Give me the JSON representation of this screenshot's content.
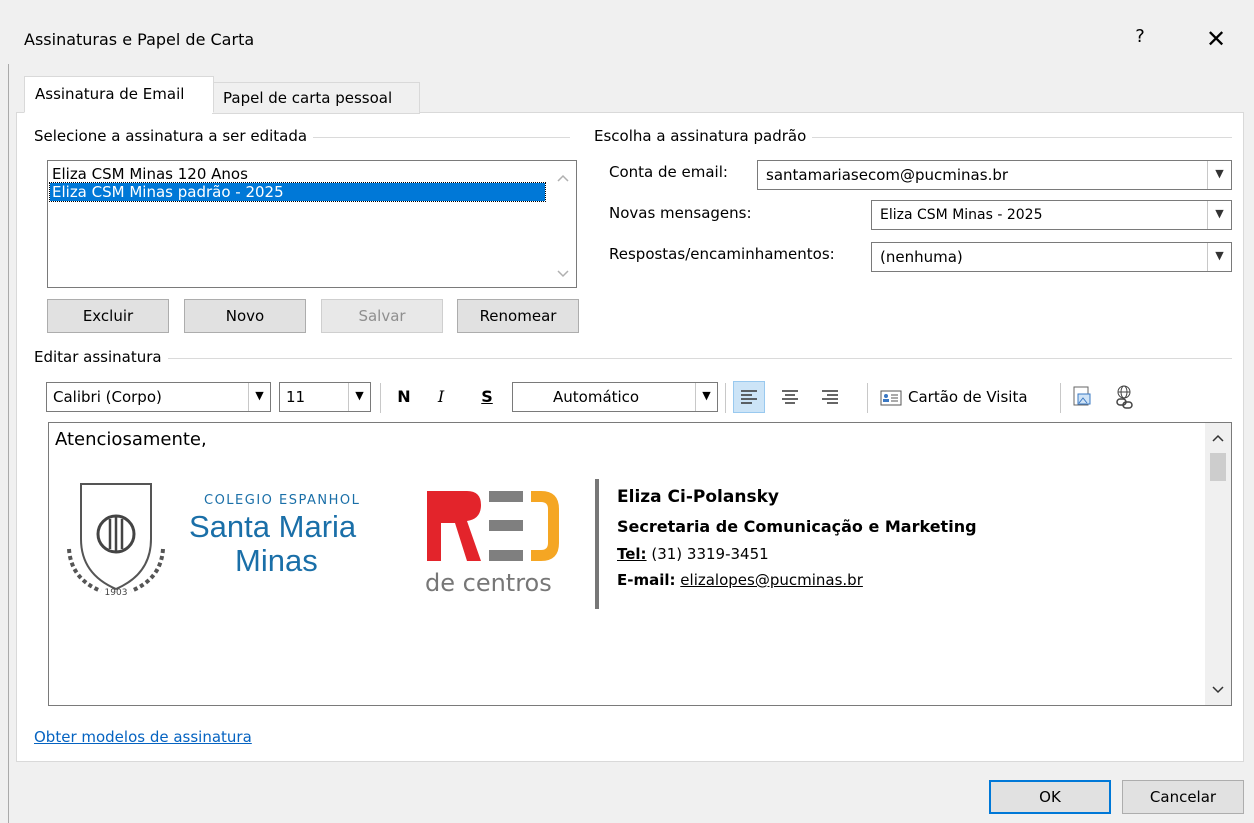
{
  "window": {
    "title": "Assinaturas e Papel de Carta",
    "help": "?",
    "close": "✕"
  },
  "tabs": [
    {
      "label": "Assinatura de Email",
      "active": true
    },
    {
      "label": "Papel de carta pessoal",
      "active": false
    }
  ],
  "select_section": {
    "label": "Selecione a assinatura a ser editada",
    "items": [
      "Eliza CSM Minas 120 Anos",
      "Eliza CSM Minas padrão - 2025"
    ],
    "selected_index": 1,
    "buttons": {
      "delete": "Excluir",
      "new": "Novo",
      "save": "Salvar",
      "rename": "Renomear"
    }
  },
  "default_section": {
    "label": "Escolha a assinatura padrão",
    "account_label": "Conta de email:",
    "account_value": "santamariasecom@pucminas.br",
    "new_messages_label": "Novas mensagens:",
    "new_messages_value": "Eliza CSM Minas - 2025",
    "replies_label": "Respostas/encaminhamentos:",
    "replies_value": "(nenhuma)"
  },
  "edit_section": {
    "label": "Editar assinatura",
    "font_value": "Calibri (Corpo)",
    "size_value": "11",
    "bold": "N",
    "italic": "I",
    "underline": "S",
    "color_value": "Automático",
    "business_card": "Cartão de Visita"
  },
  "signature": {
    "greeting": "Atenciosamente,",
    "school_line1": "COLEGIO ESPANHOL",
    "school_line2": "Santa Maria",
    "school_line3": "Minas",
    "school_year": "1903",
    "red_text": "RED",
    "red_sub": "de centros",
    "name": "Eliza Ci-Polansky",
    "role": "Secretaria de Comunicação e Marketing",
    "tel_label": "Tel:",
    "tel_value": "(31) 3319-3451",
    "email_label": "E-mail:",
    "email_value": "elizalopes@pucminas.br"
  },
  "footer": {
    "templates_link": "Obter modelos de assinatura",
    "ok": "OK",
    "cancel": "Cancelar"
  },
  "colors": {
    "accent": "#0078d7",
    "school_blue": "#1a6fa8",
    "red_red": "#e3242b",
    "red_yellow": "#f5a623",
    "link": "#0563c1"
  }
}
